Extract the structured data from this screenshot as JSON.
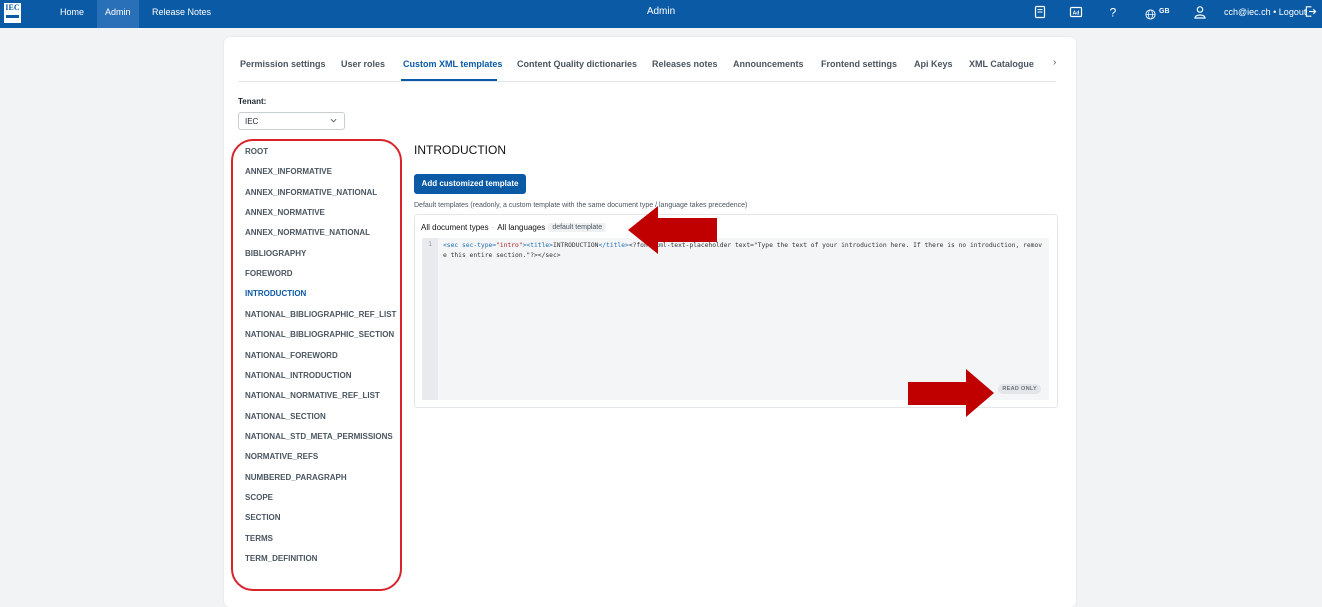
{
  "topbar": {
    "logo_text": "IEC",
    "nav": [
      {
        "label": "Home"
      },
      {
        "label": "Admin"
      },
      {
        "label": "Release Notes"
      }
    ],
    "title": "Admin",
    "icons": [
      "book-icon",
      "ad-icon",
      "help-icon",
      "globe-icon",
      "user-icon",
      "logout-icon"
    ],
    "language": "GB",
    "user_text": "cch@iec.ch • Logout"
  },
  "tabs": [
    {
      "label": "Permission settings"
    },
    {
      "label": "User roles"
    },
    {
      "label": "Custom XML templates"
    },
    {
      "label": "Content Quality dictionaries"
    },
    {
      "label": "Releases notes"
    },
    {
      "label": "Announcements"
    },
    {
      "label": "Frontend settings"
    },
    {
      "label": "Api Keys"
    },
    {
      "label": "XML Catalogue"
    }
  ],
  "tabs_next": "›",
  "tenant": {
    "label": "Tenant:",
    "value": "IEC"
  },
  "tree": [
    "ROOT",
    "ANNEX_INFORMATIVE",
    "ANNEX_INFORMATIVE_NATIONAL",
    "ANNEX_NORMATIVE",
    "ANNEX_NORMATIVE_NATIONAL",
    "BIBLIOGRAPHY",
    "FOREWORD",
    "INTRODUCTION",
    "NATIONAL_BIBLIOGRAPHIC_REF_LIST",
    "NATIONAL_BIBLIOGRAPHIC_SECTION",
    "NATIONAL_FOREWORD",
    "NATIONAL_INTRODUCTION",
    "NATIONAL_NORMATIVE_REF_LIST",
    "NATIONAL_SECTION",
    "NATIONAL_STD_META_PERMISSIONS",
    "NORMATIVE_REFS",
    "NUMBERED_PARAGRAPH",
    "SCOPE",
    "SECTION",
    "TERMS",
    "TERM_DEFINITION"
  ],
  "selected_item": "INTRODUCTION",
  "detail": {
    "title": "INTRODUCTION",
    "add_button": "Add customized template",
    "default_note": "Default templates (readonly, a custom template with the same document type / language takes precedence)",
    "doc_types": "All document types",
    "separator": "·",
    "languages": "All languages",
    "badge": "default template",
    "line_number": "1",
    "code": {
      "p1": "<sec sec-type=",
      "p2": "\"intro\"",
      "p3": "><title>",
      "p4": "INTRODUCTION",
      "p5": "</title>",
      "p6": "<?fontoxml-text-placeholder text=",
      "p7": "\"Type the text of your introduction here. If there is no introduction, remove this entire section.\"",
      "p8": "?></sec>"
    },
    "read_only": "READ ONLY"
  },
  "colors": {
    "brand": "#0b5aa6",
    "annotation_red": "#c00000"
  }
}
